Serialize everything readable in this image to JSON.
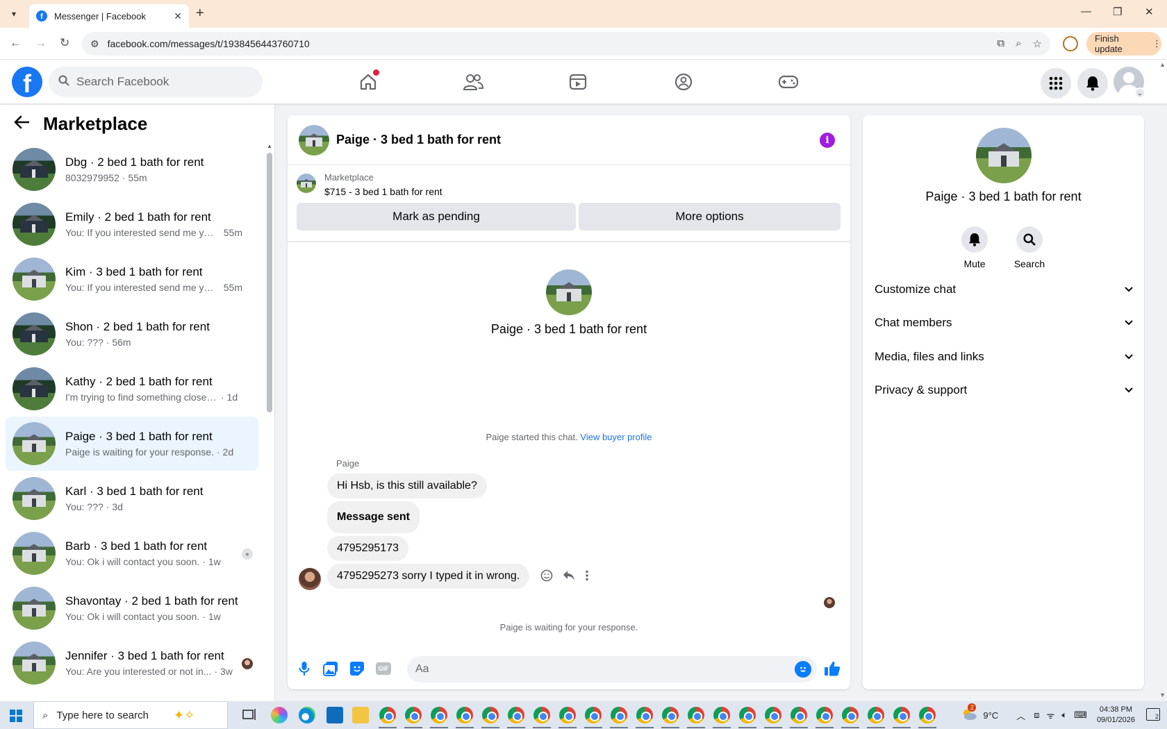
{
  "browser": {
    "tab_title": "Messenger | Facebook",
    "url": "facebook.com/messages/t/1938456443760710",
    "finish_update_label": "Finish update"
  },
  "fbnav": {
    "search_placeholder": "Search Facebook"
  },
  "sidebar": {
    "title": "Marketplace",
    "conversations": [
      {
        "name": "Dbg · 2 bed 1 bath for rent",
        "preview": "8032979952",
        "time": "· 55m",
        "thumb": "dark"
      },
      {
        "name": "Emily · 2 bed 1 bath for rent",
        "preview": "You: If you interested send me yo...",
        "time": "55m",
        "thumb": "dark"
      },
      {
        "name": "Kim · 3 bed 1 bath for rent",
        "preview": "You: If you interested send me yo...",
        "time": "55m",
        "thumb": "light"
      },
      {
        "name": "Shon · 2 bed 1 bath for rent",
        "preview": "You: ???",
        "time": "· 56m",
        "thumb": "dark"
      },
      {
        "name": "Kathy · 2 bed 1 bath for rent",
        "preview": "I'm trying to find something close t...",
        "time": "· 1d",
        "thumb": "dark"
      },
      {
        "name": "Paige · 3 bed 1 bath for rent",
        "preview": "Paige is waiting for your response.",
        "time": "· 2d",
        "thumb": "light",
        "active": true
      },
      {
        "name": "Karl · 3 bed 1 bath for rent",
        "preview": "You: ???",
        "time": "· 3d",
        "thumb": "light"
      },
      {
        "name": "Barb · 3 bed 1 bath for rent",
        "preview": "You: Ok i will contact you soon.",
        "time": "· 1w",
        "thumb": "light",
        "seen": "placeholder"
      },
      {
        "name": "Shavontay · 2 bed 1 bath for rent",
        "preview": "You: Ok i will contact you soon.",
        "time": "· 1w",
        "thumb": "light"
      },
      {
        "name": "Jennifer · 3 bed 1 bath for rent",
        "preview": "You: Are you interested or not in...",
        "time": "· 3w",
        "thumb": "light",
        "seen": "photo"
      }
    ]
  },
  "chat": {
    "title": "Paige · 3 bed 1 bath for rent",
    "marketplace_label": "Marketplace",
    "listing": "$715 - 3 bed 1 bath for rent",
    "mark_pending_label": "Mark as pending",
    "more_options_label": "More options",
    "center_name": "Paige · 3 bed 1 bath for rent",
    "started_text": "Paige started this chat.",
    "view_profile_label": "View buyer profile",
    "sender": "Paige",
    "messages": [
      {
        "text": "Hi Hsb, is this still available?",
        "bold": false
      },
      {
        "text": "Message sent",
        "bold": true
      },
      {
        "text": "4795295173",
        "bold": false
      },
      {
        "text": "4795295273 sorry I typed it in wrong.",
        "bold": false
      }
    ],
    "waiting_text": "Paige is waiting for your response.",
    "composer_placeholder": "Aa",
    "gif_label": "GIF"
  },
  "info_panel": {
    "name": "Paige · 3 bed 1 bath for rent",
    "mute_label": "Mute",
    "search_label": "Search",
    "sections": [
      "Customize chat",
      "Chat members",
      "Media, files and links",
      "Privacy & support"
    ]
  },
  "taskbar": {
    "search_placeholder": "Type here to search",
    "weather_temp": "9°C",
    "weather_badge": "2",
    "time": "04:38 PM",
    "date": "09/01/2026",
    "notif_count": "2"
  },
  "colors": {
    "fb_blue": "#1877f2",
    "messenger_blue": "#0a7cff",
    "info_purple": "#a01ce0",
    "active_conv_bg": "#ebf5ff"
  }
}
